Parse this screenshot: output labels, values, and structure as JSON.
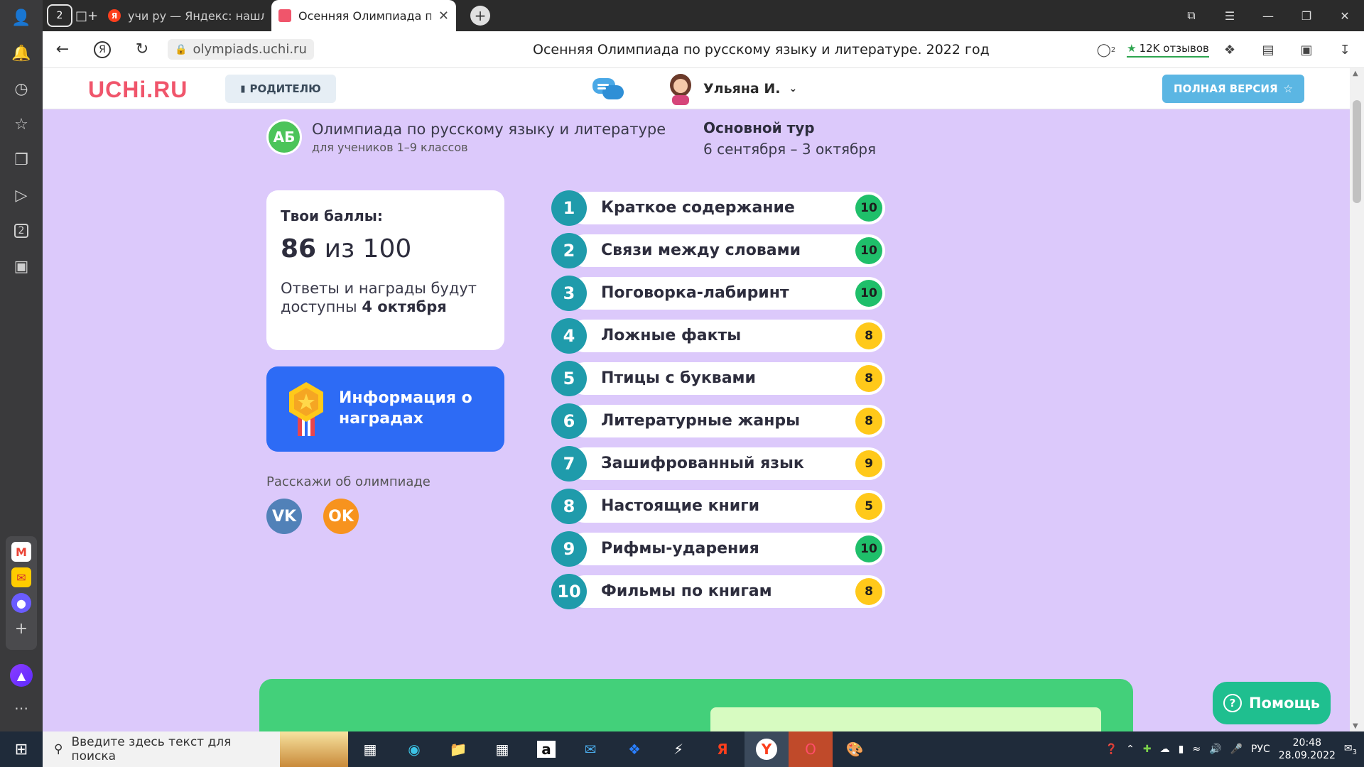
{
  "browser": {
    "tabs": [
      {
        "title": "учи ру — Яндекс: нашлос",
        "favicon": "Я",
        "active": false
      },
      {
        "title": "Осенняя Олимпиада по",
        "favicon": "",
        "active": true
      }
    ],
    "home_count": "2",
    "url": "olympiads.uchi.ru",
    "page_title": "Осенняя Олимпиада по русскому языку и литературе. 2022 год",
    "reviews": "12K отзывов",
    "shield_count": "2",
    "sidebar_badge": "2"
  },
  "site": {
    "logo": "UCHi.RU",
    "parent_label": "РОДИТЕЛЮ",
    "user_name": "Ульяна И.",
    "full_version_label": "ПОЛНАЯ ВЕРСИЯ"
  },
  "olympiad": {
    "badge": "АБ",
    "title": "Олимпиада по русскому языку и литературе",
    "subtitle": "для учеников 1–9 классов",
    "tour_title": "Основной тур",
    "tour_dates": "6 сентября – 3 октября"
  },
  "score": {
    "label": "Твои баллы:",
    "value": "86",
    "of_text": "из 100",
    "note_prefix": "Ответы и награды будут доступны",
    "note_date": "4 октября"
  },
  "awards": {
    "label_line1": "Информация о",
    "label_line2": "наградах"
  },
  "share": {
    "label": "Расскажи об олимпиаде",
    "vk": "VK",
    "ok": "OK"
  },
  "tasks": [
    {
      "num": "1",
      "name": "Краткое содержание",
      "points": "10",
      "color": "green"
    },
    {
      "num": "2",
      "name": "Связи между словами",
      "points": "10",
      "color": "green"
    },
    {
      "num": "3",
      "name": "Поговорка-лабиринт",
      "points": "10",
      "color": "green"
    },
    {
      "num": "4",
      "name": "Ложные факты",
      "points": "8",
      "color": "yellow"
    },
    {
      "num": "5",
      "name": "Птицы с буквами",
      "points": "8",
      "color": "yellow"
    },
    {
      "num": "6",
      "name": "Литературные жанры",
      "points": "8",
      "color": "yellow"
    },
    {
      "num": "7",
      "name": "Зашифрованный язык",
      "points": "9",
      "color": "yellow"
    },
    {
      "num": "8",
      "name": "Настоящие книги",
      "points": "5",
      "color": "yellow"
    },
    {
      "num": "9",
      "name": "Рифмы-ударения",
      "points": "10",
      "color": "green"
    },
    {
      "num": "10",
      "name": "Фильмы по книгам",
      "points": "8",
      "color": "yellow"
    }
  ],
  "help_label": "Помощь",
  "taskbar": {
    "search_placeholder": "Введите здесь текст для поиска",
    "lang": "РУС",
    "time": "20:48",
    "date": "28.09.2022",
    "notifications": "3"
  },
  "colors": {
    "page_bg": "#dcc9fb",
    "accent_blue": "#2d6bf5",
    "task_num": "#1f9bab",
    "points_green": "#1fbf6a",
    "points_yellow": "#ffc91a",
    "logo": "#f0556b"
  }
}
